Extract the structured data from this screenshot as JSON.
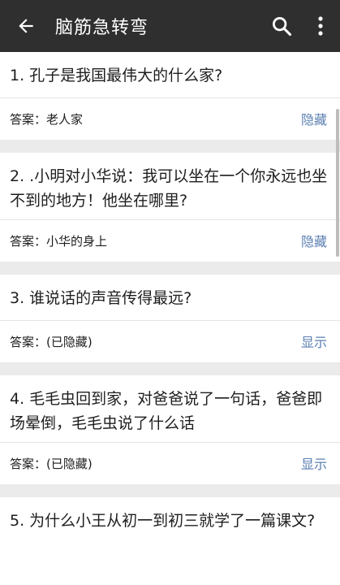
{
  "appbar": {
    "title": "脑筋急转弯"
  },
  "questions": [
    {
      "question": "1. 孔子是我国最伟大的什么家?",
      "answer": "答案：老人家",
      "toggle": "隐藏"
    },
    {
      "question": "2. .小明对小华说：我可以坐在一个你永远也坐不到的地方！他坐在哪里?",
      "answer": "答案：小华的身上",
      "toggle": "隐藏"
    },
    {
      "question": "3. 谁说话的声音传得最远?",
      "answer": "答案：(已隐藏)",
      "toggle": "显示"
    },
    {
      "question": "4. 毛毛虫回到家，对爸爸说了一句话，爸爸即场晕倒，毛毛虫说了什么话",
      "answer": "答案：(已隐藏)",
      "toggle": "显示"
    },
    {
      "question": "5. 为什么小王从初一到初三就学了一篇课文?"
    }
  ]
}
